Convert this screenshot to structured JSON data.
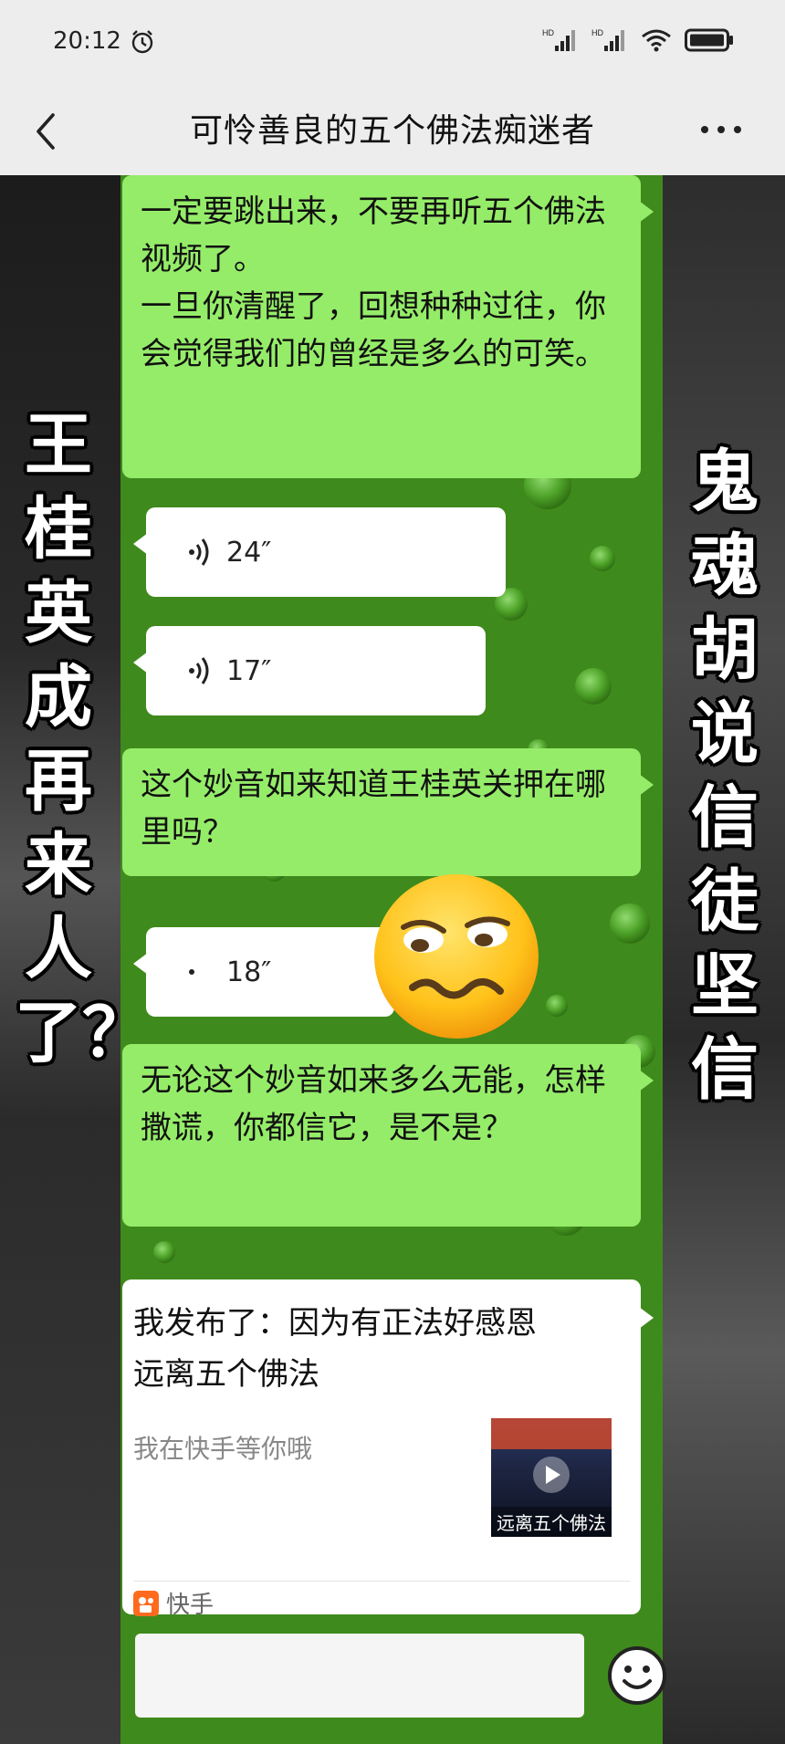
{
  "status_bar": {
    "time": "20:12",
    "icons": [
      "alarm-icon",
      "signal-icon",
      "signal-icon",
      "wifi-icon",
      "battery-icon"
    ]
  },
  "nav": {
    "title": "可怜善良的五个佛法痴迷者",
    "back_icon": "chevron-left-icon",
    "more_icon": "more-dots-icon"
  },
  "overlay": {
    "left_text": "王桂英成再来人了？",
    "right_text": "鬼魂胡说信徒坚信"
  },
  "messages": [
    {
      "type": "text",
      "side": "right",
      "text": "一定要跳出来，不要再听五个佛法视频了。\n一旦你清醒了，回想种种过往，你会觉得我们的曾经是多么的可笑。"
    },
    {
      "type": "voice",
      "side": "left",
      "duration": "24″"
    },
    {
      "type": "voice",
      "side": "left",
      "duration": "17″"
    },
    {
      "type": "text",
      "side": "right",
      "text": "这个妙音如来知道王桂英关押在哪里吗？"
    },
    {
      "type": "voice",
      "side": "left",
      "duration": "18″"
    },
    {
      "type": "text",
      "side": "right",
      "text": "无论这个妙音如来多么无能，怎样撒谎，你都信它，是不是？"
    },
    {
      "type": "share",
      "side": "right",
      "title": "我发布了：因为有正法好感恩远离五个佛法",
      "subtitle": "我在快手等你哦",
      "thumb_caption": "远离五个佛法",
      "source": "快手"
    }
  ],
  "sticker": "woozy-face-emoji",
  "input": {
    "emoji_icon": "smiley-icon"
  },
  "colors": {
    "bubble_green": "#95ec69",
    "chat_bg": "#3f8a1c",
    "header_bg": "#ededed"
  }
}
